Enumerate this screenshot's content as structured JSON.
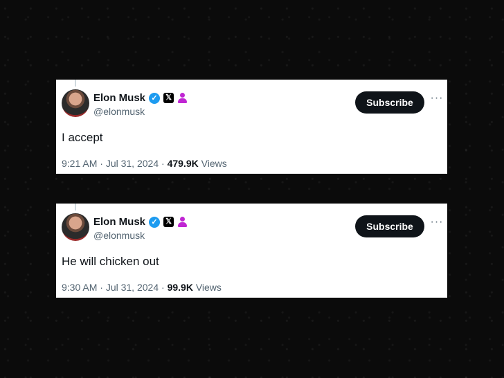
{
  "tweets": [
    {
      "name": "Elon Musk",
      "handle": "@elonmusk",
      "subscribe_label": "Subscribe",
      "more_label": "···",
      "text": "I accept",
      "time": "9:21 AM",
      "date": "Jul 31, 2024",
      "views_count": "479.9K",
      "views_label": "Views",
      "sep": "·"
    },
    {
      "name": "Elon Musk",
      "handle": "@elonmusk",
      "subscribe_label": "Subscribe",
      "more_label": "···",
      "text": "He will chicken out",
      "time": "9:30 AM",
      "date": "Jul 31, 2024",
      "views_count": "99.9K",
      "views_label": "Views",
      "sep": "·"
    }
  ],
  "icons": {
    "verified": "verified-check-icon",
    "x_logo": "x-logo-icon",
    "affiliate": "affiliate-person-icon"
  },
  "colors": {
    "verified": "#1d9bf0",
    "affiliate": "#c026d3",
    "button": "#0f1419",
    "muted": "#536471"
  }
}
